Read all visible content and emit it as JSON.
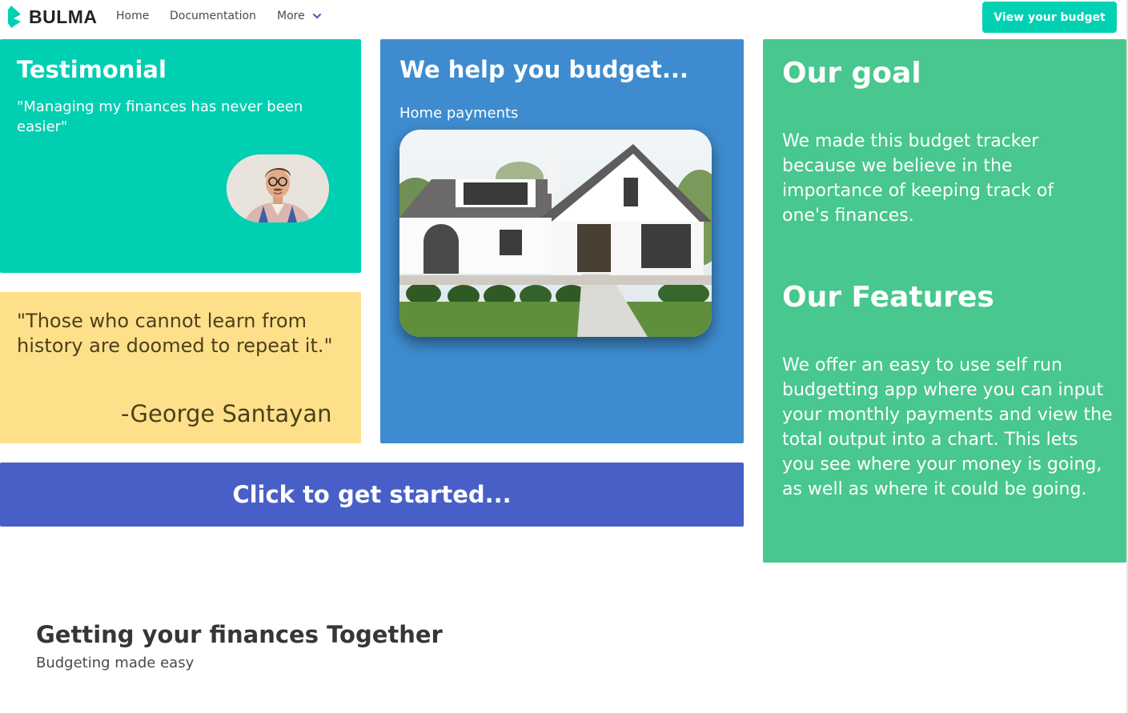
{
  "navbar": {
    "brand": "BULMA",
    "items": [
      "Home",
      "Documentation",
      "More"
    ],
    "cta": "View your budget"
  },
  "testimonial": {
    "title": "Testimonial",
    "text": "\"Managing my finances has never been easier\""
  },
  "quote": {
    "text": "\"Those who cannot learn from history are doomed to repeat it.\"",
    "author": "-George Santayan"
  },
  "budget": {
    "title": "We help you budget...",
    "subtitle": "Home payments"
  },
  "goal": {
    "title": "Our goal",
    "text": "We made this budget tracker because we believe in the importance of keeping track of one's finances."
  },
  "features": {
    "title": "Our Features",
    "text": "We offer an easy to use self run budgetting app where you can input your monthly payments and view the total output into a chart. This lets you see where your money is going, as well as where it could be going."
  },
  "cta": {
    "label": "Click to get started..."
  },
  "hero": {
    "title_plain": "Getting your finances ",
    "title_bold": "Together",
    "subtitle": "Budgeting made easy"
  },
  "colors": {
    "primary": "#00d1b2",
    "testimonial_bg": "#00cfb1",
    "quote_bg": "#fee08b",
    "budget_bg": "#3e8ccf",
    "goal_bg": "#48c78e",
    "cta_bg": "#485fc7"
  }
}
